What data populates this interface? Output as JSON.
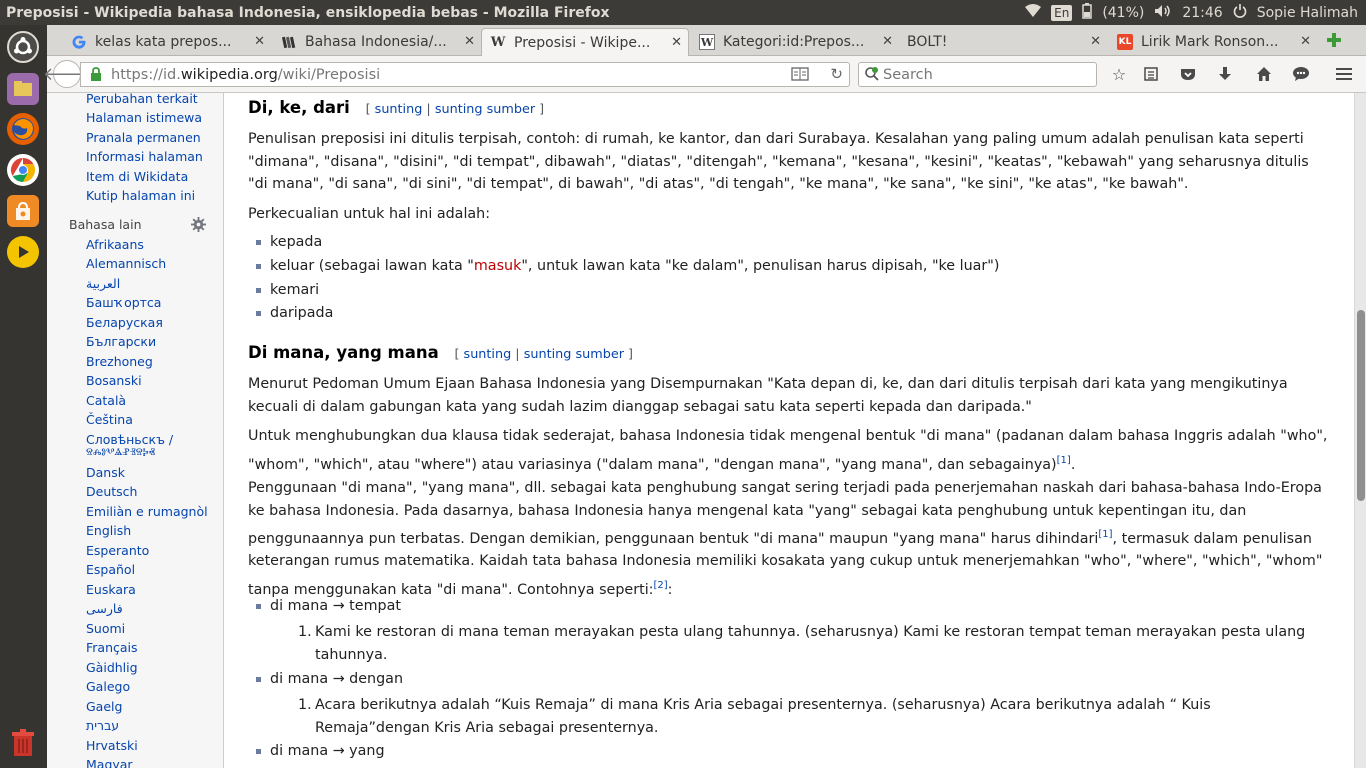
{
  "os_bar": {
    "window_title": "Preposisi - Wikipedia bahasa Indonesia, ensiklopedia bebas - Mozilla Firefox",
    "lang": "En",
    "battery": "(41%)",
    "time": "21:46",
    "user": "Sopie Halimah"
  },
  "launcher": [
    "ubuntu-icon",
    "files-icon",
    "firefox-icon",
    "chrome-icon",
    "software-center-icon",
    "media-player-icon",
    "trash-icon"
  ],
  "tabs": [
    {
      "label": "kelas kata prepos...",
      "icon": "google-icon"
    },
    {
      "label": "Bahasa Indonesia/...",
      "icon": "wikibooks-icon"
    },
    {
      "label": "Preposisi - Wikipe...",
      "icon": "wikipedia-icon"
    },
    {
      "label": "Kategori:id:Prepos...",
      "icon": "wiktionary-icon"
    },
    {
      "label": "BOLT!",
      "icon": ""
    },
    {
      "label": "Lirik Mark Ronson...",
      "icon": "kapanlagi-icon"
    }
  ],
  "nav": {
    "url_prefix": "https://id.",
    "url_domain": "wikipedia.org",
    "url_path": "/wiki/Preposisi",
    "search_placeholder": "Search"
  },
  "sidebar": {
    "tools": [
      "Perubahan terkait",
      "Halaman istimewa",
      "Pranala permanen",
      "Informasi halaman",
      "Item di Wikidata",
      "Kutip halaman ini"
    ],
    "lang_heading": "Bahasa lain",
    "languages": [
      "Afrikaans",
      "Alemannisch",
      "العربية",
      "Башҡортса",
      "Беларуская",
      "Български",
      "Brezhoneg",
      "Bosanski",
      "Català",
      "Čeština",
      "Словѣньскъ /",
      "ⰔⰎⰑⰂⰡⰐⰠⰔⰍⰟ",
      "Dansk",
      "Deutsch",
      "Emiliàn e rumagnòl",
      "English",
      "Esperanto",
      "Español",
      "Euskara",
      "فارسی",
      "Suomi",
      "Français",
      "Gàidhlig",
      "Galego",
      "Gaelg",
      "עברית",
      "Hrvatski",
      "Magyar"
    ]
  },
  "article": {
    "sunting": "sunting",
    "sunting_sumber": "sunting sumber",
    "h_dikedari": "Di, ke, dari",
    "p1": "Penulisan preposisi ini ditulis terpisah, contoh: di rumah, ke kantor, dan dari Surabaya. Kesalahan yang paling umum adalah penulisan kata seperti \"dimana\", \"disana\", \"disini\", \"di tempat\", dibawah\", \"diatas\", \"ditengah\", \"kemana\", \"kesana\", \"kesini\", \"keatas\", \"kebawah\" yang seharusnya ditulis \"di mana\", \"di sana\", \"di sini\", \"di tempat\", di bawah\", \"di atas\", \"di tengah\", \"ke mana\", \"ke sana\", \"ke sini\", \"ke atas\", \"ke bawah\".",
    "p2": "Perkecualian untuk hal ini adalah:",
    "list1": [
      "kepada",
      "keluar (sebagai lawan kata \"",
      "masuk",
      "\", untuk lawan kata \"ke dalam\", penulisan harus dipisah, \"ke luar\")",
      "kemari",
      "daripada"
    ],
    "h_dimana": "Di mana, yang mana",
    "p3": "Menurut Pedoman Umum Ejaan Bahasa Indonesia yang Disempurnakan \"Kata depan di, ke, dan dari ditulis terpisah dari kata yang mengikutinya kecuali di dalam gabungan kata yang sudah lazim dianggap sebagai satu kata seperti kepada dan daripada.\"",
    "p4": "Untuk menghubungkan dua klausa tidak sederajat, bahasa Indonesia tidak mengenal bentuk \"di mana\" (padanan dalam bahasa Inggris adalah \"who\", \"whom\", \"which\", atau \"where\") atau variasinya (\"dalam mana\", \"dengan mana\", \"yang mana\", dan sebagainya)",
    "ref1": "[1]",
    "p5a": "Penggunaan \"di mana\", \"yang mana\", dll. sebagai kata penghubung sangat sering terjadi pada penerjemahan naskah dari bahasa-bahasa Indo-Eropa ke bahasa Indonesia. Pada dasarnya, bahasa Indonesia hanya mengenal kata \"yang\" sebagai kata penghubung untuk kepentingan itu, dan penggunaannya pun terbatas. Dengan demikian, penggunaan bentuk \"di mana\" maupun \"yang mana\" harus dihindari",
    "p5b": ", termasuk dalam penulisan keterangan rumus matematika. Kaidah tata bahasa Indonesia memiliki kosakata yang cukup untuk menerjemahkan \"who\", \"where\", \"which\", \"whom\" tanpa menggunakan kata \"di mana\". Contohnya seperti:",
    "ref2": "[2]",
    "list2": [
      "di mana → tempat",
      "Kami ke restoran di mana teman merayakan pesta ulang tahunnya. (seharusnya) Kami ke restoran tempat teman merayakan pesta ulang tahunnya.",
      "di mana → dengan",
      "Acara berikutnya adalah “Kuis Remaja” di mana Kris Aria sebagai presenternya. (seharusnya) Acara berikutnya adalah “ Kuis Remaja”dengan Kris Aria sebagai presenternya.",
      "di mana → yang"
    ]
  }
}
